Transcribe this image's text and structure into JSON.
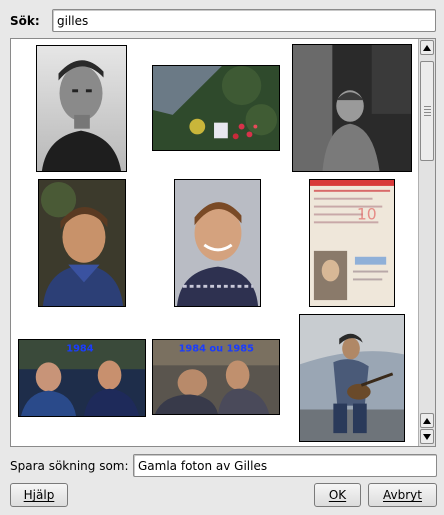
{
  "search": {
    "label": "Sök:",
    "value": "gilles"
  },
  "results": {
    "thumbnails": [
      {
        "name": "thumb-passport-portrait",
        "icon": "photo-icon",
        "description_color": "#777777"
      },
      {
        "name": "thumb-garden-aerial",
        "icon": "photo-icon",
        "description_color": "#2e4a2a"
      },
      {
        "name": "thumb-child-bw",
        "icon": "photo-icon",
        "description_color": "#444444"
      },
      {
        "name": "thumb-boy-blue-shirt",
        "icon": "photo-icon",
        "description_color": "#2a3c6a"
      },
      {
        "name": "thumb-boy-sweater",
        "icon": "photo-icon",
        "description_color": "#3a3d58"
      },
      {
        "name": "thumb-id-card",
        "icon": "photo-icon",
        "description_color": "#e0d4c0"
      },
      {
        "name": "thumb-two-boys-1984",
        "icon": "photo-icon",
        "overlay_text": "1984",
        "description_color": "#1a2a6a"
      },
      {
        "name": "thumb-two-boys-1984-1985",
        "icon": "photo-icon",
        "overlay_text": "1984 ou 1985",
        "description_color": "#55504a"
      },
      {
        "name": "thumb-guitar-player",
        "icon": "photo-icon",
        "description_color": "#7b8ea8"
      }
    ],
    "scrollbar": {
      "up_icon": "arrow-up-icon",
      "down_icon": "arrow-down-icon",
      "position": 0.0
    }
  },
  "save_search": {
    "label": "Spara sökning som:",
    "value": "Gamla foton av Gilles"
  },
  "buttons": {
    "help": "Hjälp",
    "ok": "OK",
    "cancel": "Avbryt"
  },
  "colors": {
    "window_bg": "#e8e8e8",
    "panel_bg": "#ffffff",
    "border": "#8a8a8a",
    "overlay_text": "#1a3cff"
  }
}
